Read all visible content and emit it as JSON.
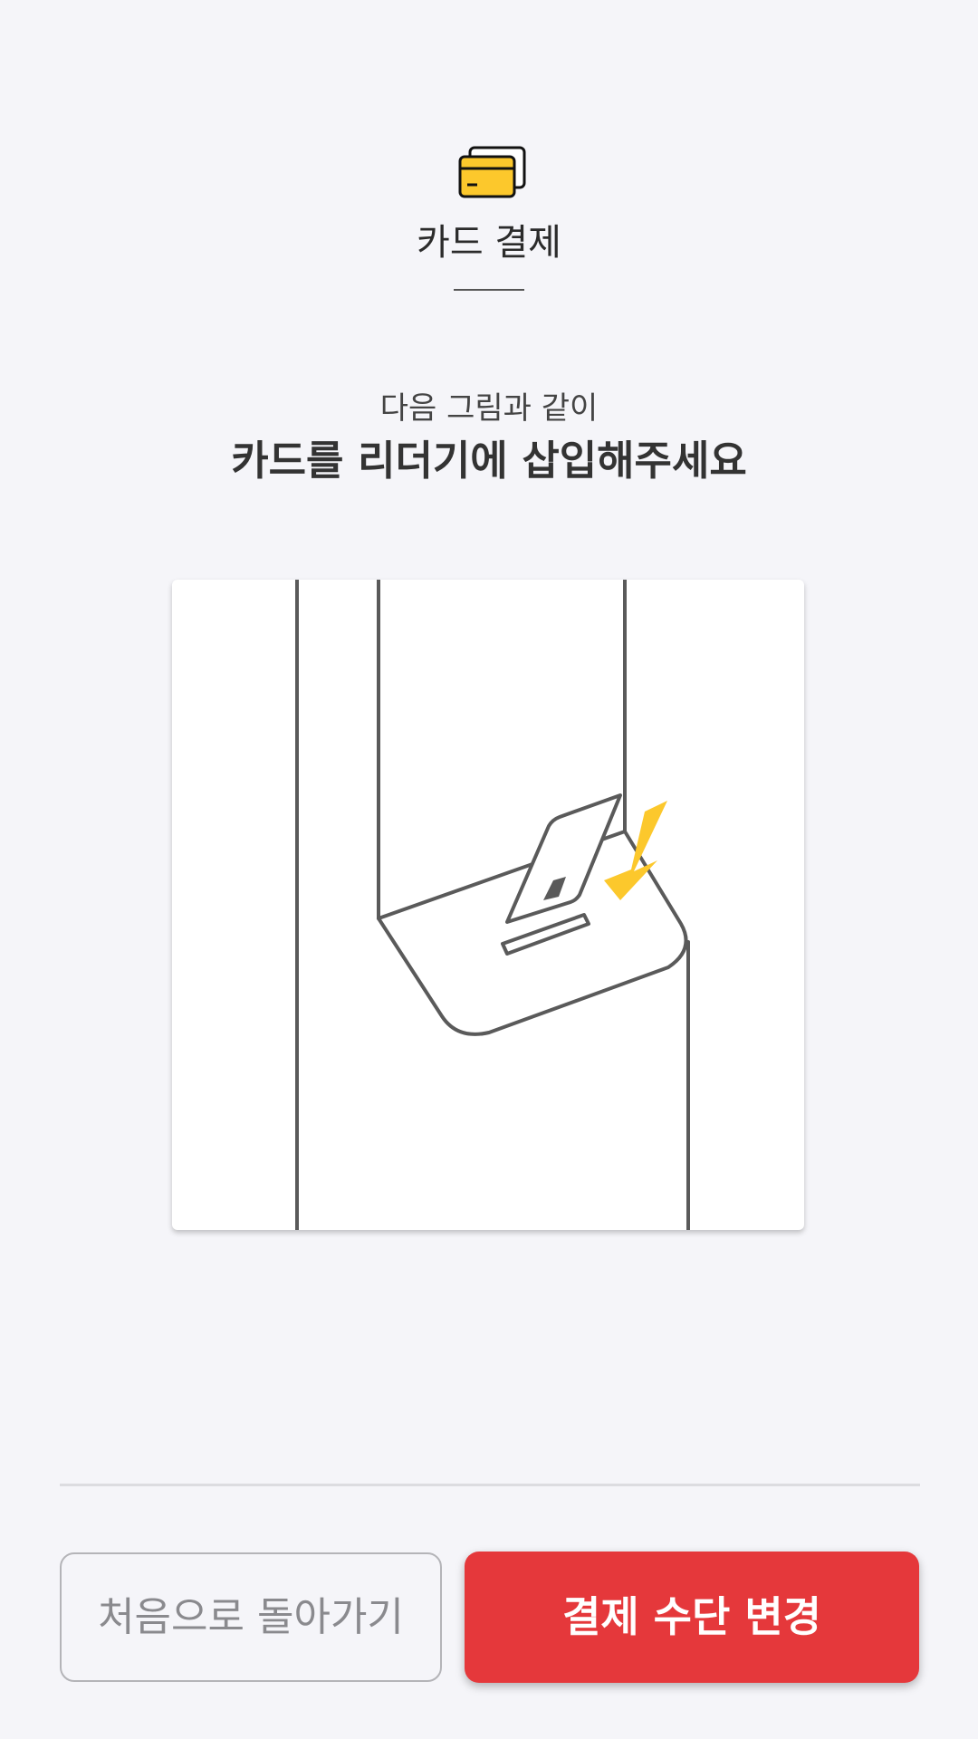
{
  "header": {
    "icon": "credit-card-icon",
    "title": "카드 결제"
  },
  "instructions": {
    "subtitle": "다음 그림과 같이",
    "headline": "카드를 리더기에 삽입해주세요"
  },
  "illustration": {
    "name": "card-insert-illustration",
    "accent_color": "#fcc82c",
    "line_color": "#5a5a5a"
  },
  "buttons": {
    "back_label": "처음으로 돌아가기",
    "change_label": "결제 수단 변경"
  },
  "colors": {
    "background": "#f5f5f9",
    "primary": "#e5383b",
    "card_yellow": "#fcc82c"
  }
}
